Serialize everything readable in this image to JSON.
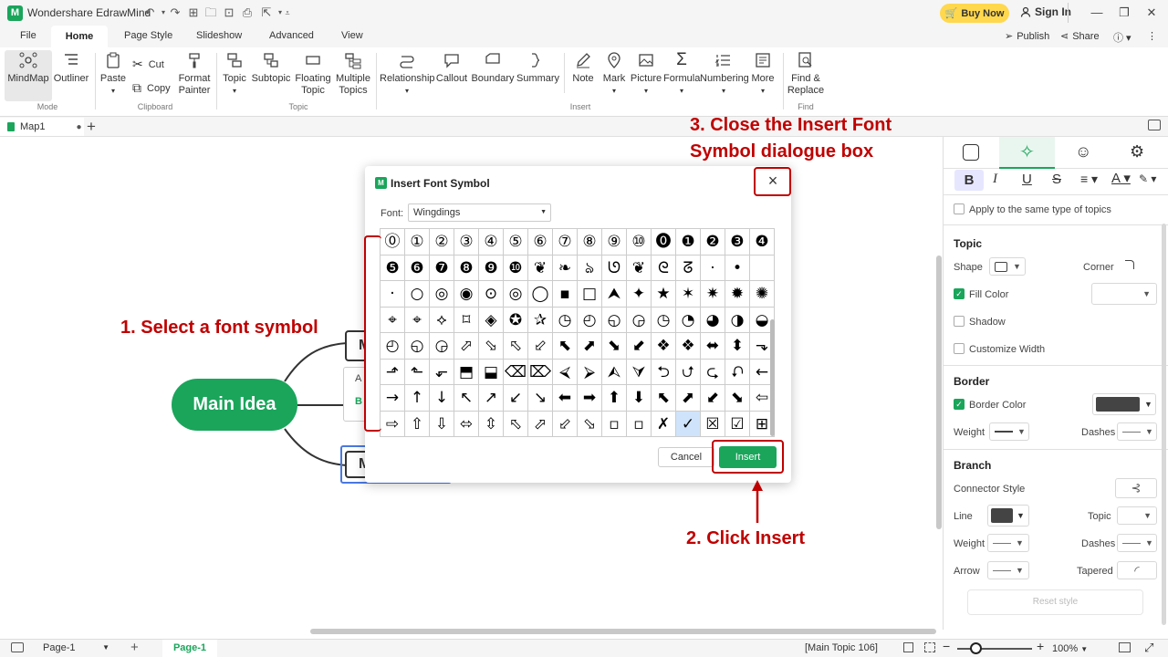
{
  "app": {
    "title": "Wondershare EdrawMind",
    "buy_label": "Buy Now",
    "signin_label": "Sign In"
  },
  "menu": {
    "items": [
      "File",
      "Home",
      "Page Style",
      "Slideshow",
      "Advanced",
      "View"
    ],
    "publish": "Publish",
    "share": "Share"
  },
  "ribbon": {
    "mode": {
      "mindmap": "MindMap",
      "outliner": "Outliner",
      "label": "Mode"
    },
    "clipboard": {
      "paste": "Paste",
      "cut": "Cut",
      "copy": "Copy",
      "format_painter_1": "Format",
      "format_painter_2": "Painter",
      "label": "Clipboard"
    },
    "topic": {
      "topic": "Topic",
      "subtopic": "Subtopic",
      "floating_1": "Floating",
      "floating_2": "Topic",
      "multiple_1": "Multiple",
      "multiple_2": "Topics",
      "label": "Topic"
    },
    "insert": {
      "relationship": "Relationship",
      "callout": "Callout",
      "boundary": "Boundary",
      "summary": "Summary",
      "note": "Note",
      "mark": "Mark",
      "picture": "Picture",
      "formula": "Formula",
      "numbering": "Numbering",
      "more": "More",
      "label": "Insert"
    },
    "find": {
      "find_1": "Find &",
      "find_2": "Replace",
      "label": "Find"
    }
  },
  "doc_tab": {
    "name": "Map1"
  },
  "canvas": {
    "main_idea": "Main Idea",
    "topic_letters": [
      "M",
      "A",
      "B",
      "M"
    ]
  },
  "dialog": {
    "title": "Insert Font Symbol",
    "font_label": "Font:",
    "font_value": "Wingdings",
    "cancel": "Cancel",
    "insert": "Insert",
    "close": "×",
    "symbols": [
      [
        "⓪",
        "①",
        "②",
        "③",
        "④",
        "⑤",
        "⑥",
        "⑦",
        "⑧",
        "⑨",
        "⑩",
        "⓿",
        "❶",
        "❷",
        "❸",
        "❹"
      ],
      [
        "❺",
        "❻",
        "❼",
        "❽",
        "❾",
        "❿",
        "❦",
        "❧",
        "ঌ",
        "ᘎ",
        "❦",
        "ᘓ",
        "ᘔ",
        "·",
        "•",
        ""
      ],
      [
        "·",
        "○",
        "◎",
        "◉",
        "⊙",
        "◎",
        "◯",
        "▪",
        "□",
        "⮝",
        "✦",
        "★",
        "✶",
        "✷",
        "✹",
        "✺"
      ],
      [
        "⌖",
        "⌖",
        "⟡",
        "⌑",
        "◈",
        "✪",
        "✰",
        "◷",
        "◴",
        "◵",
        "◶",
        "◷",
        "◔",
        "◕",
        "◑",
        "◒"
      ],
      [
        "◴",
        "◵",
        "◶",
        "⬀",
        "⬂",
        "⬁",
        "⬃",
        "⬉",
        "⬈",
        "⬊",
        "⬋",
        "❖",
        "❖",
        "⬌",
        "⬍",
        "⬎"
      ],
      [
        "⬏",
        "⬑",
        "⬐",
        "⬒",
        "⬓",
        "⌫",
        "⌦",
        "⮘",
        "⮚",
        "⮙",
        "⮛",
        "⮌",
        "⮍",
        "⮎",
        "⮏",
        "←"
      ],
      [
        "→",
        "↑",
        "↓",
        "↖",
        "↗",
        "↙",
        "↘",
        "⬅",
        "➡",
        "⬆",
        "⬇",
        "⬉",
        "⬈",
        "⬋",
        "⬊",
        "⇦"
      ],
      [
        "⇨",
        "⇧",
        "⇩",
        "⬄",
        "⇳",
        "⬁",
        "⬀",
        "⬃",
        "⬂",
        "▫",
        "▫",
        "✗",
        "✓",
        "☒",
        "☑",
        "⊞"
      ]
    ]
  },
  "panel": {
    "apply_same": "Apply to the same type of topics",
    "topic_head": "Topic",
    "shape": "Shape",
    "corner": "Corner",
    "fill_color": "Fill Color",
    "shadow": "Shadow",
    "custom_width": "Customize Width",
    "border_head": "Border",
    "border_color": "Border Color",
    "weight": "Weight",
    "dashes": "Dashes",
    "branch_head": "Branch",
    "connector_style": "Connector Style",
    "line": "Line",
    "topic": "Topic",
    "arrow": "Arrow",
    "tapered": "Tapered",
    "reset": "Reset style"
  },
  "status": {
    "page": "Page-1",
    "page_tab": "Page-1",
    "selection": "[Main Topic 106]",
    "zoom": "100%"
  },
  "annotations": {
    "step1": "1. Select a font symbol",
    "step2": "2. Click Insert",
    "step3_line1": "3. Close the Insert Font",
    "step3_line2": "Symbol dialogue box"
  },
  "colors": {
    "brand_green": "#1aa55b",
    "annotation_red": "#c00000",
    "buy_yellow": "#ffd84d",
    "selection_blue": "#cfe4fb"
  }
}
